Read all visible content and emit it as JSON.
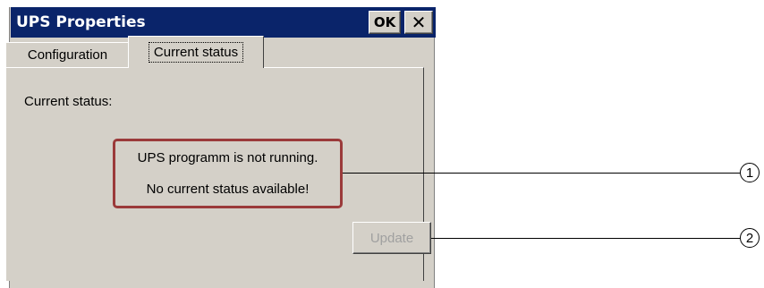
{
  "window": {
    "title": "UPS Properties",
    "ok_label": "OK",
    "close_glyph": "✕"
  },
  "tabs": [
    {
      "label": "Configuration",
      "active": false
    },
    {
      "label": "Current status",
      "active": true
    }
  ],
  "panel": {
    "status_label": "Current status:",
    "message_line1": "UPS programm is not running.",
    "message_line2": "No current status available!",
    "update_label": "Update",
    "update_enabled": false
  },
  "callouts": [
    "1",
    "2"
  ],
  "colors": {
    "titlebar": "#0a246a",
    "dialog_bg": "#d4d0c8",
    "highlight_border": "#9b3a3a",
    "disabled_text": "#a0a0a0"
  }
}
